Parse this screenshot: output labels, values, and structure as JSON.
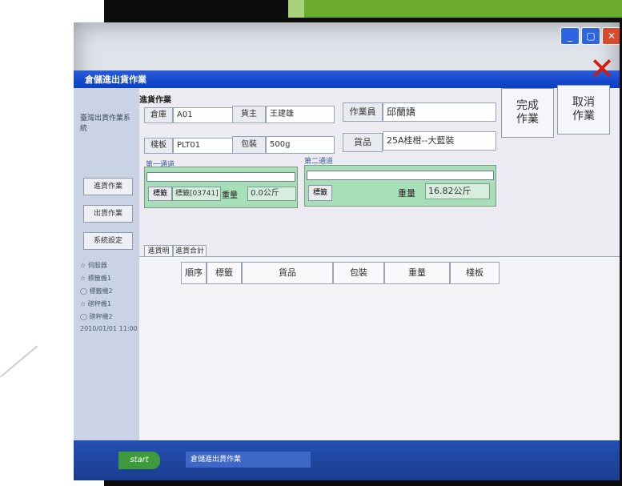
{
  "window": {
    "title": "倉儲進出貨作業",
    "min": "_",
    "max": "▢",
    "close": "✕"
  },
  "close_x": "✕",
  "sidebar": {
    "logo": "臺灣出貨作業系統",
    "buttons": [
      "進貨作業",
      "出貨作業",
      "系統設定"
    ],
    "status": [
      "☆ 伺服器",
      "☆ 標籤機1",
      "◯ 標籤機2",
      "☆ 磅秤機1",
      "◯ 磅秤機2",
      "2010/01/01 11:00"
    ]
  },
  "form": {
    "title": "進貨作業",
    "warehouse_label": "倉庫",
    "warehouse_value": "A01",
    "owner_label": "貨主",
    "owner_value": "王建雄",
    "operator_label": "作業員",
    "operator_value": "邱蘭嬌",
    "pallet_label": "棧板",
    "pallet_value": "PLT01",
    "pack_label": "包裝",
    "pack_value": "500g",
    "goods_label": "貨品",
    "goods_value": "25A桂柑--大藍裝"
  },
  "actions": {
    "complete": "完成\n作業",
    "cancel": "取消\n作業"
  },
  "channel1": {
    "title": "第一通道",
    "tag_label": "標籤",
    "tag_value": "標籤[03741]",
    "weight_label": "重量",
    "weight_value": "0.0公斤"
  },
  "channel2": {
    "title": "第二通道",
    "tag_label": "標籤",
    "weight_label": "重量",
    "weight_value": "16.82公斤"
  },
  "tabs": [
    "進貨明細",
    "進貨合計"
  ],
  "table": {
    "columns": [
      "順序",
      "標籤",
      "貨品",
      "包裝",
      "重量",
      "棧板"
    ]
  },
  "taskbar": {
    "start": "start",
    "app": "倉儲進出貨作業"
  }
}
